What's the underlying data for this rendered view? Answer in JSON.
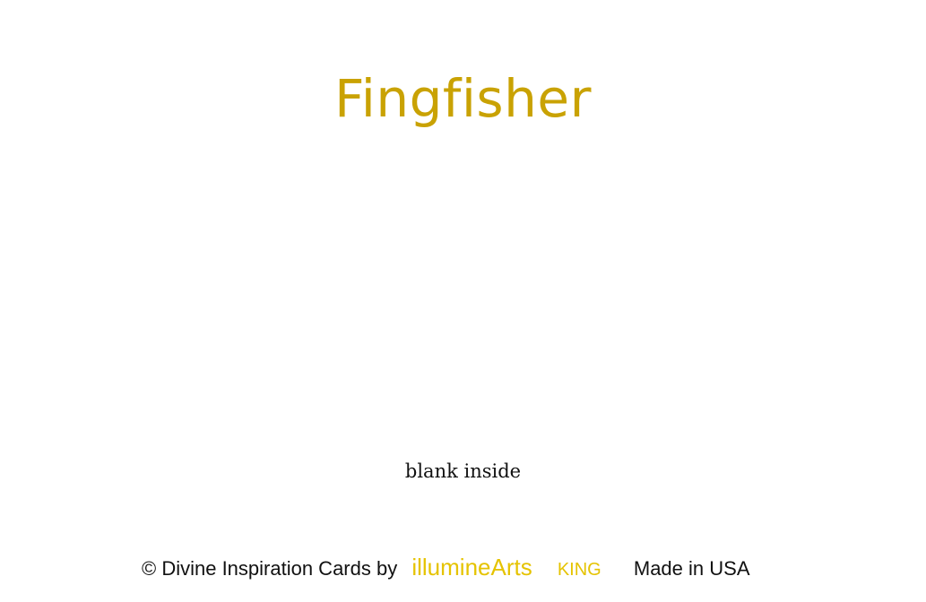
{
  "card": {
    "title": "Fingfisher",
    "subtitle": "blank inside",
    "footer": {
      "copyright": "© Divine Inspiration Cards by",
      "brand": "illumineArts",
      "size": "KING",
      "origin": "Made in USA"
    },
    "colors": {
      "title": "#c9a203",
      "brand": "#e5c300",
      "text": "#111111"
    }
  }
}
